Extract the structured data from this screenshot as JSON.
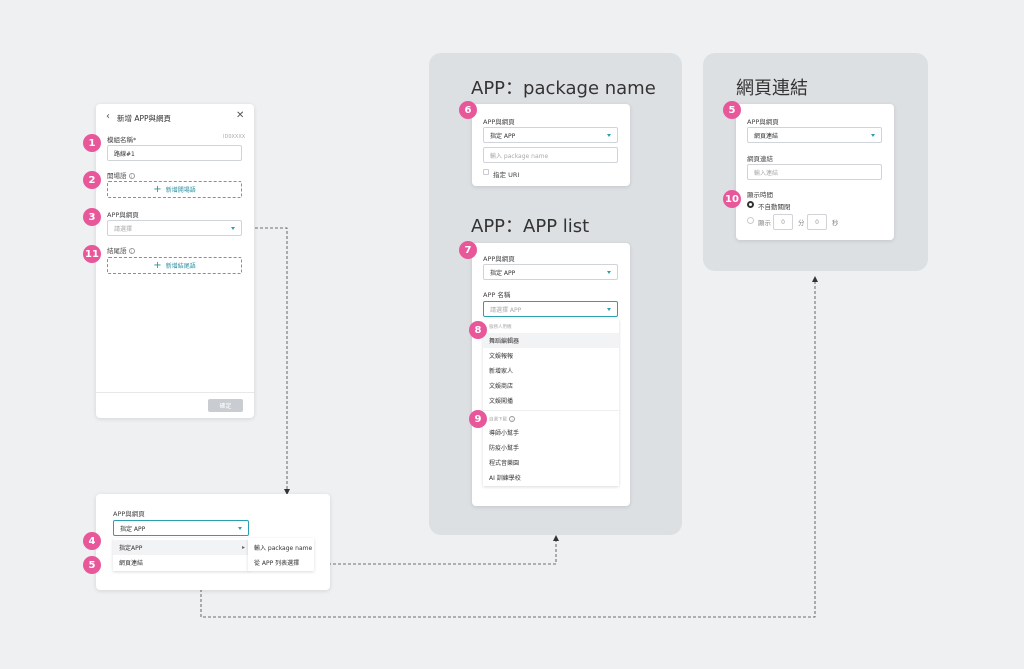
{
  "form": {
    "title": "新增 APP與網頁",
    "name_label": "模組名稱*",
    "name_counter": "ID0XXXX",
    "name_value": "路線#1",
    "opening_label": "開場語",
    "opening_button": "新增開場語",
    "app_label": "APP與網頁",
    "app_placeholder": "請選擇",
    "closing_label": "結尾語",
    "closing_button": "新增結尾語",
    "confirm_button": "確定"
  },
  "dropdown_demo": {
    "label": "APP與網頁",
    "selected": "指定 APP",
    "options": [
      "指定APP",
      "網頁連結"
    ],
    "submenu": [
      "輸入 package name",
      "從 APP 列表選擇"
    ]
  },
  "package_panel": {
    "title": "APP：package name",
    "label": "APP與網頁",
    "selected": "指定 APP",
    "package_placeholder": "輸入 package name",
    "uri_label": "指定 URI"
  },
  "applist_panel": {
    "title": "APP：APP list",
    "label": "APP與網頁",
    "selected": "指定 APP",
    "name_label": "APP 名稱",
    "name_placeholder": "請選擇 APP",
    "group1_head": "服務人用機",
    "group1_items": [
      "舞蹈編輯器",
      "文娛報報",
      "新增家人",
      "文娛商店",
      "文娛闖播"
    ],
    "group2_head": "自選下載",
    "group2_items": [
      "導師小幫手",
      "防疫小幫手",
      "程式音樂園",
      "AI 訓練學校"
    ]
  },
  "web_panel": {
    "title": "網頁連結",
    "app_label": "APP與網頁",
    "selected": "網頁連結",
    "link_label": "網頁連結",
    "link_placeholder": "輸入連結",
    "duration_label": "顯示時間",
    "auto_close": "不自動關閉",
    "show_label": "顯示",
    "min_value": "0",
    "min_unit": "分",
    "sec_value": "0",
    "sec_unit": "秒"
  },
  "badges": {
    "b1": "1",
    "b2": "2",
    "b3": "3",
    "b11": "11",
    "b4": "4",
    "b5a": "5",
    "b6": "6",
    "b7": "7",
    "b8": "8",
    "b9": "9",
    "b5b": "5",
    "b10": "10"
  },
  "colors": {
    "accent": "#2b9fb0",
    "badge": "#e8579a",
    "panel": "#dde0e3"
  }
}
